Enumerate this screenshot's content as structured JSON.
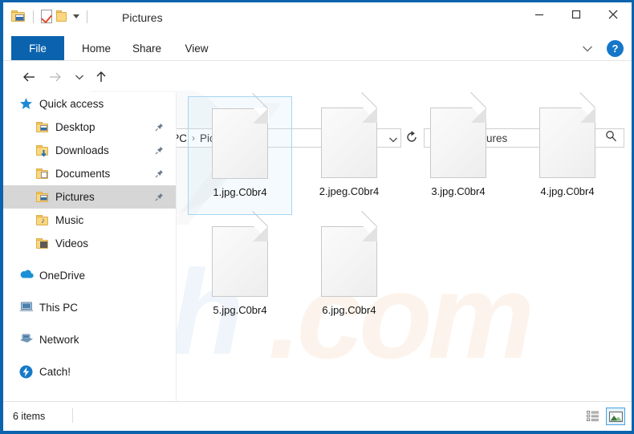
{
  "window": {
    "title": "Pictures",
    "accent_color": "#0b63ae",
    "quick_access_toolbar": [
      {
        "name": "folder-picture-icon",
        "label": "Pictures folder"
      },
      {
        "name": "properties-icon",
        "label": "Properties"
      },
      {
        "name": "new-folder-icon",
        "label": "New folder"
      },
      {
        "name": "customize-qat-caret",
        "label": "Customize Quick Access Toolbar"
      }
    ],
    "controls": {
      "minimize": "Minimize",
      "maximize": "Maximize",
      "close": "Close"
    }
  },
  "ribbon": {
    "tabs": [
      {
        "label": "File",
        "active": true
      },
      {
        "label": "Home",
        "active": false
      },
      {
        "label": "Share",
        "active": false
      },
      {
        "label": "View",
        "active": false
      }
    ],
    "collapse_label": "Minimize the Ribbon",
    "help_label": "?"
  },
  "address_bar": {
    "back_label": "Back",
    "forward_label": "Forward",
    "recent_label": "Recent locations",
    "up_label": "Up",
    "breadcrumb": [
      "This PC",
      "Pictures"
    ],
    "breadcrumb_separator": "›",
    "dropdown_label": "Previous locations",
    "refresh_label": "Refresh"
  },
  "search": {
    "placeholder": "Search Pictures",
    "value": "",
    "icon": "search-icon"
  },
  "sidebar": {
    "items": [
      {
        "label": "Quick access",
        "icon": "star-icon",
        "indent": 0,
        "selected": false,
        "pinned": false
      },
      {
        "label": "Desktop",
        "icon": "folder-desktop-icon",
        "indent": 1,
        "selected": false,
        "pinned": true
      },
      {
        "label": "Downloads",
        "icon": "folder-downloads-icon",
        "indent": 1,
        "selected": false,
        "pinned": true
      },
      {
        "label": "Documents",
        "icon": "folder-documents-icon",
        "indent": 1,
        "selected": false,
        "pinned": true
      },
      {
        "label": "Pictures",
        "icon": "folder-pictures-icon",
        "indent": 1,
        "selected": true,
        "pinned": true
      },
      {
        "label": "Music",
        "icon": "folder-music-icon",
        "indent": 1,
        "selected": false,
        "pinned": false
      },
      {
        "label": "Videos",
        "icon": "folder-videos-icon",
        "indent": 1,
        "selected": false,
        "pinned": false
      },
      {
        "label": "OneDrive",
        "icon": "onedrive-cloud-icon",
        "indent": 0,
        "selected": false,
        "pinned": false,
        "gap_before": true
      },
      {
        "label": "This PC",
        "icon": "this-pc-icon",
        "indent": 0,
        "selected": false,
        "pinned": false,
        "gap_before": true
      },
      {
        "label": "Network",
        "icon": "network-icon",
        "indent": 0,
        "selected": false,
        "pinned": false,
        "gap_before": true
      },
      {
        "label": "Catch!",
        "icon": "catch-icon",
        "indent": 0,
        "selected": false,
        "pinned": false,
        "gap_before": true
      }
    ],
    "selection_color": "#d6d6d6"
  },
  "files": {
    "selection_border_color": "#a6d5f2",
    "items": [
      {
        "name": "1.jpg.C0br4",
        "icon": "generic-file-icon",
        "selected": true
      },
      {
        "name": "2.jpeg.C0br4",
        "icon": "generic-file-icon",
        "selected": false
      },
      {
        "name": "3.jpg.C0br4",
        "icon": "generic-file-icon",
        "selected": false
      },
      {
        "name": "4.jpg.C0br4",
        "icon": "generic-file-icon",
        "selected": false
      },
      {
        "name": "5.jpg.C0br4",
        "icon": "generic-file-icon",
        "selected": false
      },
      {
        "name": "6.jpg.C0br4",
        "icon": "generic-file-icon",
        "selected": false
      }
    ]
  },
  "status_bar": {
    "item_count_text": "6 items",
    "views": [
      {
        "name": "details-view-button",
        "label": "Details view",
        "active": false
      },
      {
        "name": "large-icons-view-button",
        "label": "Large icons view",
        "active": true
      }
    ]
  }
}
